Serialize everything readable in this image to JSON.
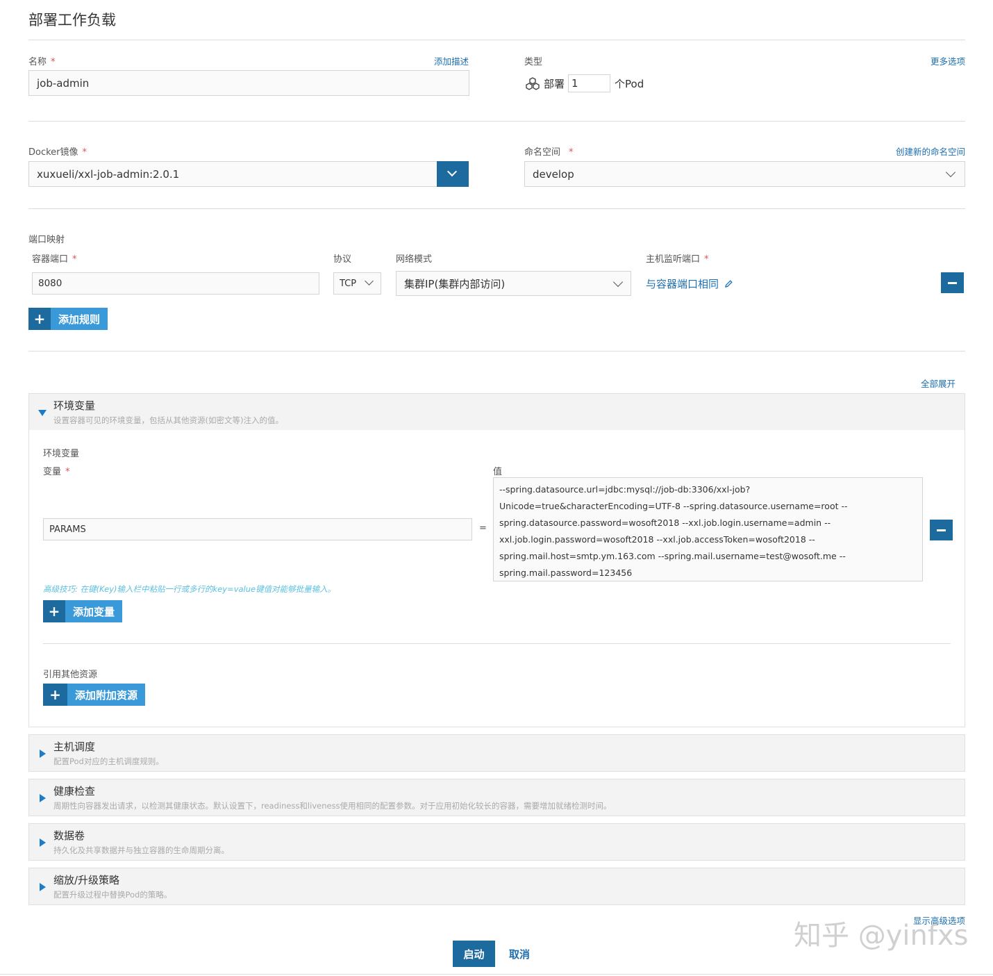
{
  "page": {
    "title": "部署工作负载"
  },
  "name_field": {
    "label": "名称",
    "required_mark": "*",
    "value": "job-admin",
    "add_description_link": "添加描述"
  },
  "type_field": {
    "label": "类型",
    "more_options_link": "更多选项",
    "kind": "部署",
    "pod_count": "1",
    "pod_suffix": "个Pod"
  },
  "docker_image": {
    "label": "Docker镜像",
    "required_mark": "*",
    "value": "xuxueli/xxl-job-admin:2.0.1"
  },
  "namespace": {
    "label": "命名空间",
    "required_mark": "*",
    "create_link": "创建新的命名空间",
    "value": "develop"
  },
  "port_mapping": {
    "section_label": "端口映射",
    "container_port_label": "容器端口",
    "required_mark": "*",
    "protocol_label": "协议",
    "network_mode_label": "网络模式",
    "host_port_label": "主机监听端口",
    "container_port_value": "8080",
    "protocol_value": "TCP",
    "network_mode_value": "集群IP(集群内部访问)",
    "host_port_value": "与容器端口相同",
    "add_rule_label": "添加规则"
  },
  "expand_all_link": "全部展开",
  "env_panel": {
    "title": "环境变量",
    "description": "设置容器可见的环境变量，包括从其他资源(如密文等)注入的值。",
    "subsection_label": "环境变量",
    "var_label": "变量",
    "required_mark": "*",
    "value_label": "值",
    "var_value": "PARAMS",
    "equals": "=",
    "value_lines": [
      "--spring.datasource.url=jdbc:mysql://job-db:3306/xxl-job?",
      "Unicode=true&characterEncoding=UTF-8 --spring.datasource.username=root --",
      "spring.datasource.password=wosoft2018 --xxl.job.login.username=admin --",
      "xxl.job.login.password=wosoft2018 --xxl.job.accessToken=wosoft2018 --",
      "spring.mail.host=smtp.ym.163.com --spring.mail.username=test@wosoft.me --",
      "spring.mail.password=123456"
    ],
    "tip": "高级技巧: 在键(Key)输入栏中粘贴一行或多行的key=value键值对能够批量输入。",
    "add_var_label": "添加变量",
    "ref_label": "引用其他资源",
    "add_resource_label": "添加附加资源"
  },
  "panels": [
    {
      "title": "主机调度",
      "description": "配置Pod对应的主机调度规则。"
    },
    {
      "title": "健康检查",
      "description": "周期性向容器发出请求，以检测其健康状态。默认设置下，readiness和liveness使用相同的配置参数。对于应用初始化较长的容器，需要增加就绪检测时间。"
    },
    {
      "title": "数据卷",
      "description": "持久化及共享数据并与独立容器的生命周期分离。"
    },
    {
      "title": "缩放/升级策略",
      "description": "配置升级过程中替换Pod的策略。"
    }
  ],
  "show_advanced_link": "显示高级选项",
  "footer": {
    "launch_label": "启动",
    "cancel_label": "取消"
  },
  "watermark": "知乎 @yinfxs",
  "colors": {
    "primary": "#1c6a9e",
    "accent": "#3a9ad9",
    "link": "#1d6fb0",
    "required": "#d9534f"
  }
}
